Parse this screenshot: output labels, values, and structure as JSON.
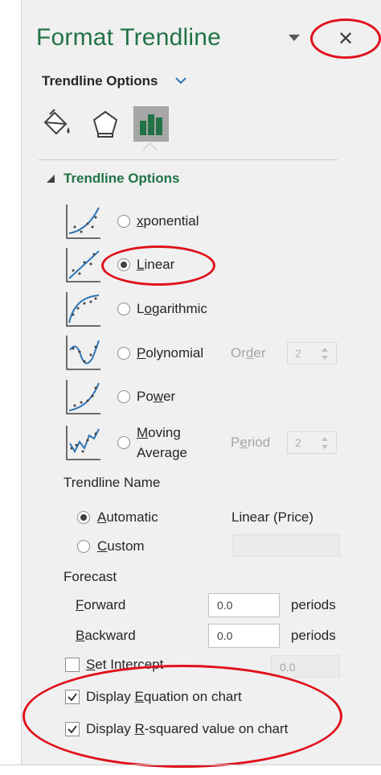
{
  "pane": {
    "title": "Format Trendline",
    "subheader": "Trendline Options",
    "tabs": [
      {
        "name": "fill-line",
        "icon": "paint-bucket-icon"
      },
      {
        "name": "effects",
        "icon": "pentagon-icon"
      },
      {
        "name": "trendline-options",
        "icon": "bar-chart-icon",
        "active": true
      }
    ],
    "section_title": "Trendline Options"
  },
  "types": {
    "exponential": {
      "pre": "",
      "key": "x",
      "post": "ponential"
    },
    "linear": {
      "pre": "",
      "key": "L",
      "post": "inear",
      "selected": true
    },
    "logarithmic": {
      "pre": "L",
      "key": "o",
      "post": "garithmic"
    },
    "polynomial": {
      "pre": "",
      "key": "P",
      "post": "olynomial"
    },
    "power": {
      "pre": "Po",
      "key": "w",
      "post": "er"
    },
    "moving_average": {
      "line1_key": "M",
      "line1_post": "oving",
      "line2": "Average"
    }
  },
  "order": {
    "pre": "Or",
    "key": "d",
    "post": "er",
    "value": "2"
  },
  "period": {
    "pre": "P",
    "key": "e",
    "post": "riod",
    "value": "2"
  },
  "trendline_name": {
    "heading": "Trendline Name",
    "automatic": {
      "key": "A",
      "post": "utomatic",
      "value": "Linear (Price)",
      "selected": true
    },
    "custom": {
      "key": "C",
      "post": "ustom",
      "value": ""
    }
  },
  "forecast": {
    "heading": "Forecast",
    "forward": {
      "key": "F",
      "post": "orward",
      "value": "0.0",
      "unit": "periods"
    },
    "backward": {
      "key": "B",
      "post": "ackward",
      "value": "0.0",
      "unit": "periods"
    }
  },
  "set_intercept": {
    "key": "S",
    "post": "et Intercept",
    "value": "0.0",
    "checked": false
  },
  "display_equation": {
    "pre": "Display ",
    "key": "E",
    "post": "quation on chart",
    "checked": true
  },
  "display_r2": {
    "pre": "Display ",
    "key": "R",
    "post": "-squared value on chart",
    "checked": true
  },
  "colors": {
    "accent": "#217346",
    "highlight": "#e0101a",
    "pane_bg": "#f0f0f0",
    "icon_blue": "#2e75b6"
  }
}
